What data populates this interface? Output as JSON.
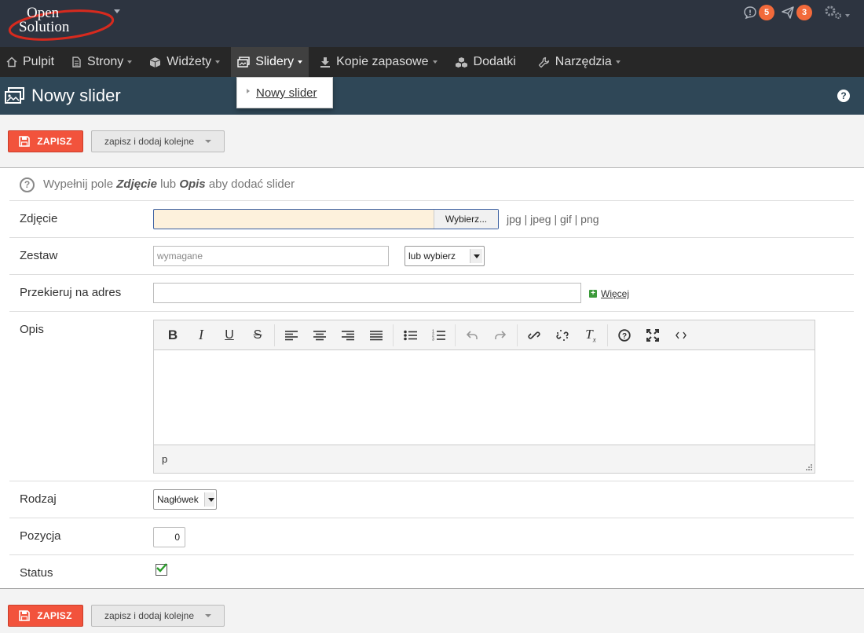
{
  "brand": {
    "line1": "Open",
    "line2": "Solution"
  },
  "top_icons": [
    {
      "name": "notifications-icon",
      "badge": "5"
    },
    {
      "name": "messages-icon",
      "badge": "3"
    },
    {
      "name": "settings-icon"
    }
  ],
  "nav": [
    {
      "label": "Pulpit",
      "icon": "home-icon",
      "dropdown": false
    },
    {
      "label": "Strony",
      "icon": "document-icon",
      "dropdown": true
    },
    {
      "label": "Widżety",
      "icon": "cube-icon",
      "dropdown": true
    },
    {
      "label": "Slidery",
      "icon": "images-icon",
      "dropdown": true,
      "active": true
    },
    {
      "label": "Kopie zapasowe",
      "icon": "download-icon",
      "dropdown": true
    },
    {
      "label": "Dodatki",
      "icon": "cubes-icon",
      "dropdown": false
    },
    {
      "label": "Narzędzia",
      "icon": "wrench-icon",
      "dropdown": true
    }
  ],
  "dropdown": {
    "items": [
      "Nowy slider"
    ]
  },
  "page": {
    "title": "Nowy slider",
    "help": "?"
  },
  "actions": {
    "save": "ZAPISZ",
    "save_add": "zapisz i dodaj kolejne"
  },
  "info": {
    "prefix": "Wypełnij pole",
    "field1": "Zdjęcie",
    "mid": "lub",
    "field2": "Opis",
    "suffix": "aby dodać slider"
  },
  "form": {
    "photo": {
      "label": "Zdjęcie",
      "button": "Wybierz...",
      "formats": "jpg | jpeg | gif | png"
    },
    "set": {
      "label": "Zestaw",
      "placeholder": "wymagane",
      "select": "lub wybierz"
    },
    "redirect": {
      "label": "Przekieruj na adres",
      "value": "",
      "more": "Więcej"
    },
    "description": {
      "label": "Opis",
      "path": "p"
    },
    "type": {
      "label": "Rodzaj",
      "selected": "Nagłówek"
    },
    "position": {
      "label": "Pozycja",
      "value": "0"
    },
    "status": {
      "label": "Status",
      "checked": true
    }
  },
  "editor_toolbar": [
    "bold",
    "italic",
    "underline",
    "strikethrough",
    "align-left",
    "align-center",
    "align-right",
    "align-justify",
    "bullet-list",
    "numbered-list",
    "undo",
    "redo",
    "link",
    "unlink",
    "clear-format",
    "help",
    "fullscreen",
    "source-code"
  ],
  "colors": {
    "topbar": "#2d3440",
    "nav": "#272727",
    "header": "#2f4757",
    "accent": "#f2533c",
    "badge": "#f26a3b"
  }
}
